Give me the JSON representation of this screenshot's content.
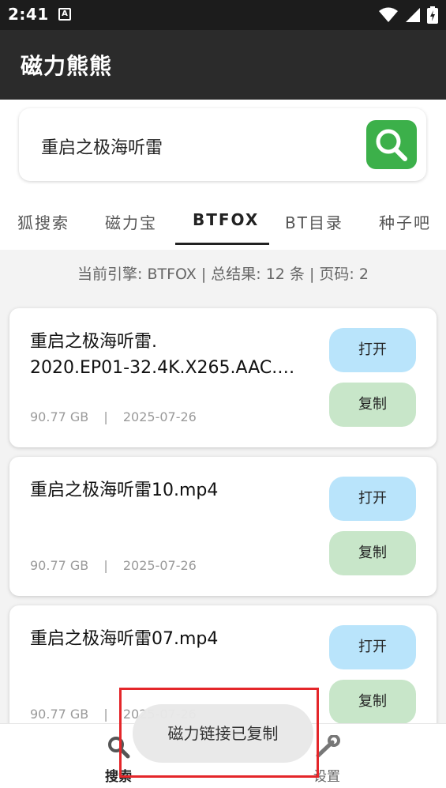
{
  "status_bar": {
    "time": "2:41",
    "notification_icon": "A"
  },
  "app": {
    "title": "磁力熊熊"
  },
  "search": {
    "query": "重启之极海听雷",
    "button_icon": "search-icon"
  },
  "tabs": [
    {
      "label": "狐搜索"
    },
    {
      "label": "磁力宝"
    },
    {
      "label": "BTFOX"
    },
    {
      "label": "BT目录"
    },
    {
      "label": "种子吧"
    }
  ],
  "engine_info": "当前引擎: BTFOX | 总结果: 12 条 | 页码: 2",
  "results": [
    {
      "name": "重启之极海听雷.\n2020.EP01-32.4K.X265.AAC.…",
      "size": "90.77 GB",
      "date": "2025-07-26",
      "open_label": "打开",
      "copy_label": "复制"
    },
    {
      "name": "重启之极海听雷10.mp4",
      "size": "90.77 GB",
      "date": "2025-07-26",
      "open_label": "打开",
      "copy_label": "复制"
    },
    {
      "name": "重启之极海听雷07.mp4",
      "size": "90.77 GB",
      "date": "2025-07-26",
      "open_label": "打开",
      "copy_label": "复制"
    }
  ],
  "meta_separator": "|",
  "bottom_nav": [
    {
      "label": "搜索",
      "icon": "search-icon"
    },
    {
      "label": "设置",
      "icon": "wrench-icon"
    }
  ],
  "toast": "磁力链接已复制",
  "colors": {
    "app_bar": "#2b2b2b",
    "search_button": "#3cb04a",
    "open_button": "#b9e4fb",
    "copy_button": "#c8e6c9",
    "highlight": "#e4262a"
  }
}
